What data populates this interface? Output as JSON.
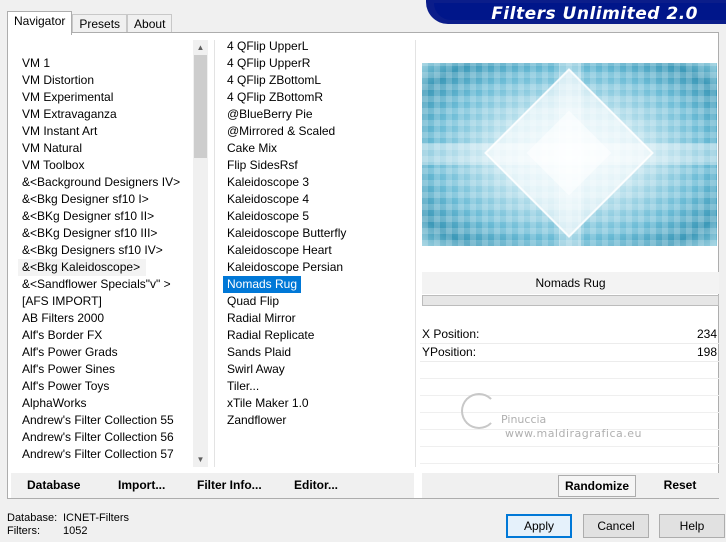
{
  "tabs": [
    "Navigator",
    "Presets",
    "About"
  ],
  "banner_title": "Filters Unlimited 2.0",
  "categories": [
    "VM 1",
    "VM Distortion",
    "VM Experimental",
    "VM Extravaganza",
    "VM Instant Art",
    "VM Natural",
    "VM Toolbox",
    "&<Background Designers IV>",
    "&<Bkg Designer sf10 I>",
    "&<BKg Designer sf10 II>",
    "&<BKg Designer sf10 III>",
    "&<Bkg Designers sf10 IV>",
    "&<Bkg Kaleidoscope>",
    "&<Sandflower Specials\"v\" >",
    "[AFS IMPORT]",
    "AB Filters 2000",
    "Alf's Border FX",
    "Alf's Power Grads",
    "Alf's Power Sines",
    "Alf's Power Toys",
    "AlphaWorks",
    "Andrew's Filter Collection 55",
    "Andrew's Filter Collection 56",
    "Andrew's Filter Collection 57"
  ],
  "categories_selected": "&<Bkg Kaleidoscope>",
  "filters": [
    "4 QFlip UpperL",
    "4 QFlip UpperR",
    "4 QFlip ZBottomL",
    "4 QFlip ZBottomR",
    "@BlueBerry Pie",
    "@Mirrored & Scaled",
    "Cake Mix",
    "Flip SidesRsf",
    "Kaleidoscope 3",
    "Kaleidoscope 4",
    "Kaleidoscope 5",
    "Kaleidoscope Butterfly",
    "Kaleidoscope Heart",
    "Kaleidoscope Persian",
    "Nomads Rug",
    "Quad Flip",
    "Radial Mirror",
    "Radial Replicate",
    "Sands Plaid",
    "Swirl Away",
    "Tiler...",
    "xTile Maker 1.0",
    "Zandflower"
  ],
  "filters_selected": "Nomads Rug",
  "filter_name": "Nomads Rug",
  "params": [
    {
      "label": "X Position:",
      "value": "234"
    },
    {
      "label": "YPosition:",
      "value": "198"
    }
  ],
  "watermark": {
    "line1": "Pinuccia",
    "line2": "www.maldiragrafica.eu"
  },
  "left_buttons": {
    "database": "Database",
    "import": "Import...",
    "filter_info": "Filter Info...",
    "editor": "Editor..."
  },
  "right_buttons": {
    "randomize": "Randomize",
    "reset": "Reset"
  },
  "status": {
    "database_label": "Database:",
    "database_value": "ICNET-Filters",
    "filters_label": "Filters:",
    "filters_value": "1052"
  },
  "dialog": {
    "apply": "Apply",
    "cancel": "Cancel",
    "help": "Help"
  },
  "colors": {
    "banner": "#00168a",
    "selection": "#0078d7"
  }
}
